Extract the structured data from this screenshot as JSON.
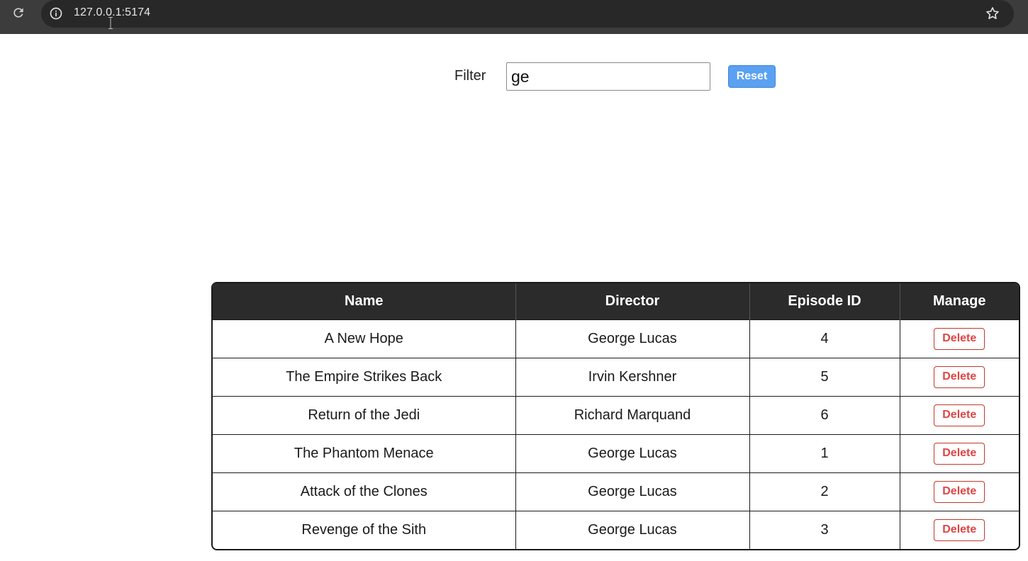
{
  "browser": {
    "url": "127.0.0.1:5174",
    "icons": {
      "reload": "reload-icon",
      "site_info": "info-icon",
      "bookmark": "star-icon"
    }
  },
  "filter": {
    "label": "Filter",
    "value": "ge",
    "reset_label": "Reset",
    "reset_color": "#5aa1f2"
  },
  "table": {
    "headers": [
      "Name",
      "Director",
      "Episode ID",
      "Manage"
    ],
    "rows": [
      {
        "name": "A New Hope",
        "director": "George Lucas",
        "episode_id": "4",
        "action": "Delete"
      },
      {
        "name": "The Empire Strikes Back",
        "director": "Irvin Kershner",
        "episode_id": "5",
        "action": "Delete"
      },
      {
        "name": "Return of the Jedi",
        "director": "Richard Marquand",
        "episode_id": "6",
        "action": "Delete"
      },
      {
        "name": "The Phantom Menace",
        "director": "George Lucas",
        "episode_id": "1",
        "action": "Delete"
      },
      {
        "name": "Attack of the Clones",
        "director": "George Lucas",
        "episode_id": "2",
        "action": "Delete"
      },
      {
        "name": "Revenge of the Sith",
        "director": "George Lucas",
        "episode_id": "3",
        "action": "Delete"
      }
    ],
    "header_bg": "#2b2b2b",
    "delete_color": "#e04444"
  }
}
